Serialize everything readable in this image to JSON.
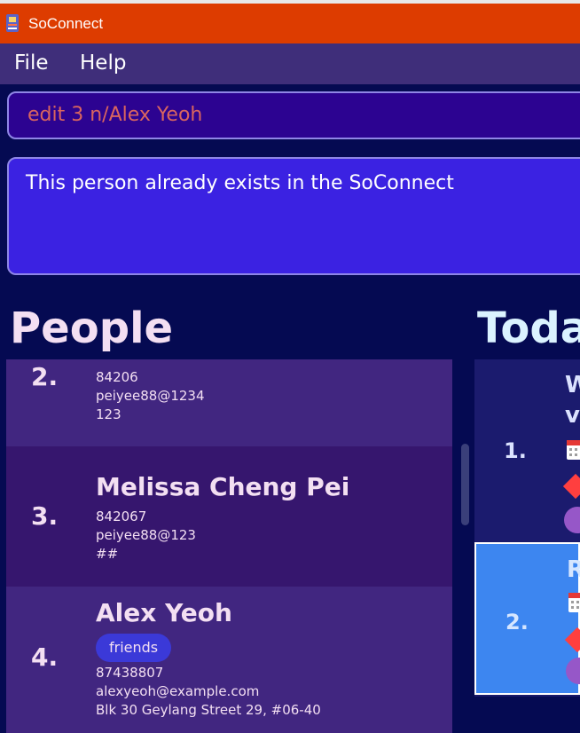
{
  "window": {
    "title": "SoConnect"
  },
  "menu": {
    "items": [
      "File",
      "Help"
    ]
  },
  "command": {
    "value": "edit 3 n/Alex Yeoh"
  },
  "result": {
    "text": "This person already exists in the SoConnect"
  },
  "headings": {
    "people": "People",
    "today": "Toda"
  },
  "people": [
    {
      "index": "2.",
      "name": "",
      "phone": "84206",
      "email": "peiyee88@1234",
      "address": "123",
      "tags": []
    },
    {
      "index": "3.",
      "name": "Melissa Cheng Pei",
      "phone": "842067",
      "email": "peiyee88@123",
      "address": "##",
      "tags": []
    },
    {
      "index": "4.",
      "name": "Alex Yeoh",
      "phone": "87438807",
      "email": "alexyeoh@example.com",
      "address": "Blk 30 Geylang Street 29, #06-40",
      "tags": [
        "friends"
      ]
    }
  ],
  "events": [
    {
      "index": "1.",
      "name_lines": [
        "W",
        "v"
      ]
    },
    {
      "index": "2.",
      "name_lines": [
        "R"
      ]
    }
  ],
  "colors": {
    "titlebar": "#dd3c00",
    "menubar": "#3f2e7a",
    "background": "#050a52",
    "command_box": "#2c0391",
    "command_text": "#d9655f",
    "result_box": "#3b22e2",
    "selected_event": "#3d86f0",
    "tag": "#3b39d8"
  }
}
